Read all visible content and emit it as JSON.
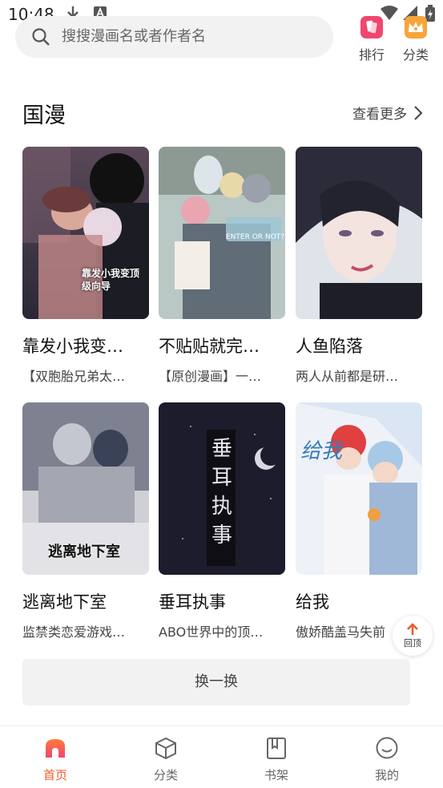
{
  "status_bar": {
    "time": "10:48"
  },
  "search": {
    "placeholder": "搜搜漫画名或者作者名"
  },
  "top_actions": [
    {
      "label": "排行",
      "color": "#f0466e"
    },
    {
      "label": "分类",
      "color": "#f7a53a"
    }
  ],
  "section": {
    "title": "国漫",
    "see_more": "查看更多"
  },
  "comics": [
    {
      "title": "靠发小我变…",
      "desc": "【双胞胎兄弟太…",
      "cover_text": "靠发小我变顶级向导"
    },
    {
      "title": "不贴贴就完…",
      "desc": "【原创漫画】一…",
      "cover_text": "ENTER OR NOT?"
    },
    {
      "title": "人鱼陷落",
      "desc": "两人从前都是研…",
      "cover_text": ""
    },
    {
      "title": "逃离地下室",
      "desc": "监禁类恋爱游戏…",
      "cover_text": "逃离地下室"
    },
    {
      "title": "垂耳执事",
      "desc": "ABO世界中的顶…",
      "cover_text": "垂耳执事"
    },
    {
      "title": "给我",
      "desc": "傲娇酷盖马失前",
      "cover_text": "给我"
    }
  ],
  "refresh_label": "换一换",
  "back_to_top": "回顶",
  "bottom_nav": [
    {
      "label": "首页",
      "active": true
    },
    {
      "label": "分类",
      "active": false
    },
    {
      "label": "书架",
      "active": false
    },
    {
      "label": "我的",
      "active": false
    }
  ],
  "colors": {
    "accent": "#f25a2a"
  }
}
